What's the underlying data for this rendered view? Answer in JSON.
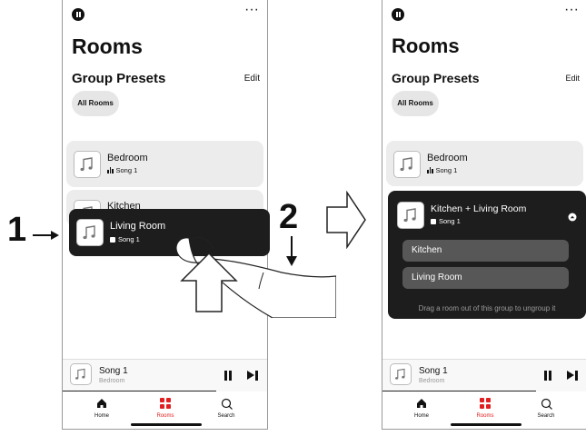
{
  "steps": {
    "one": "1",
    "two": "2"
  },
  "left": {
    "title": "Rooms",
    "section": "Group Presets",
    "edit": "Edit",
    "chip": "All Rooms",
    "cards": [
      {
        "name": "Bedroom",
        "song": "Song 1"
      },
      {
        "name": "Kitchen",
        "song": ""
      },
      {
        "name": "Living Room",
        "song": "Song 1"
      }
    ],
    "mini": {
      "song": "Song 1",
      "room": "Bedroom"
    },
    "tabs": [
      "Home",
      "Rooms",
      "Search"
    ]
  },
  "right": {
    "title": "Rooms",
    "section": "Group Presets",
    "edit": "Edit",
    "chip": "All Rooms",
    "bedroom": {
      "name": "Bedroom",
      "song": "Song 1"
    },
    "group": {
      "name": "Kitchen + Living Room",
      "song": "Song 1",
      "members": [
        "Kitchen",
        "Living Room"
      ],
      "hint": "Drag a room out of this group to ungroup it"
    },
    "mini": {
      "song": "Song 1",
      "room": "Bedroom"
    },
    "tabs": [
      "Home",
      "Rooms",
      "Search"
    ]
  },
  "colors": {
    "accent": "#e02020",
    "dark_card": "#1d1d1d",
    "card": "#ececec",
    "pill": "#575757"
  }
}
